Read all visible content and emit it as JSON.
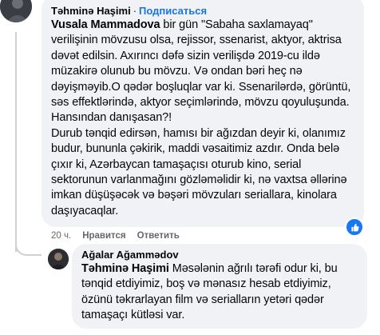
{
  "comment": {
    "author": "Təhminə Haşimi",
    "follow_label": "Подписаться",
    "separator": "·",
    "mention": "Vusala Mammadova",
    "paragraph1_rest": " bir gün \"Sabaha saxlamayaq\" verilişinin mövzusu olsa, rejissor, ssenarist, aktyor, aktrisa dəvət edilsin. Axırıncı dəfə sizin verilişdə 2019-cu ildə müzakirə olunub bu mövzu. Və ondan bəri heç nə dəyişməyib.O qədər boşluqlar var ki. Ssenarilərdə, görüntü, səs effektlərində, aktyor seçimlərində, mövzu qoyuluşunda. Hansından danışasan?!",
    "paragraph2": "Durub tənqid edirsən, hamısı bir ağızdan deyir ki, olanımız budur, bununla çəkirik, maddi vəsaitimiz azdır. Onda belə çıxır ki, Azərbaycan tamaşaçısı oturub kino, serial sektorunun varlanmağını gözləməlidir ki, nə vaxtsa əllərinə imkan düşüşəcək və bəşəri mövzuları seriallara, kinolara daşıyacaqlar.",
    "time": "20 ч.",
    "like_label": "Нравится",
    "reply_label": "Ответить",
    "reaction_icon": "like-icon",
    "reaction_color": "#1877f2"
  },
  "reply": {
    "author": "Ağalar Ağammədov",
    "mention": "Təhminə Haşimi",
    "text_rest": " Məsələnin ağrılı tərəfi odur ki, bu tənqid etdiyimiz, boş və mənasız hesab etdiyimiz, özünü təkrarlayan film və serialların yetəri qədər tamaşaçı kütləsi var."
  },
  "colors": {
    "bubble": "#f0f2f5",
    "link": "#1b74e4",
    "meta": "#65676b"
  }
}
